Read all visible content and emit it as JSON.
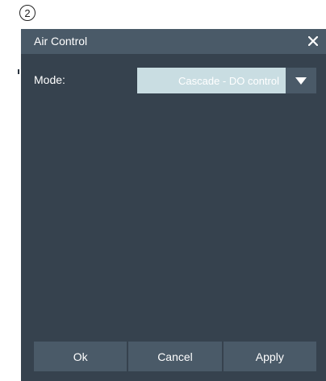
{
  "step_marker": "2",
  "dialog": {
    "title": "Air Control",
    "close_icon": "close-icon",
    "mode": {
      "label": "Mode:",
      "value": "Cascade - DO control",
      "dropdown_icon": "chevron-down-icon"
    },
    "buttons": {
      "ok": "Ok",
      "cancel": "Cancel",
      "apply": "Apply"
    }
  },
  "colors": {
    "dialog_bg": "#36424e",
    "titlebar_bg": "#4a5a68",
    "select_bg": "#c9dde2",
    "button_bg": "#4a5a68",
    "text": "#ffffff"
  }
}
